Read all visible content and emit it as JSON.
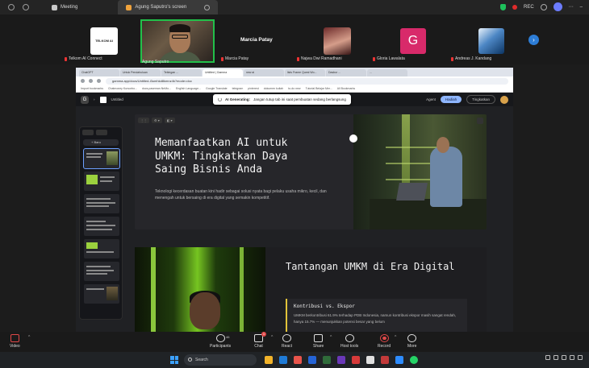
{
  "zoom_top": {
    "tabs": [
      "Meeting",
      "Agung Saputro's screen"
    ],
    "rec_label": "REC"
  },
  "participants": {
    "telkom_logo_text": "TELKOM AI CONNECT",
    "tiles": [
      "Telkom AI Connect",
      "Agung Saputro",
      "Marcia Patay",
      "Najwa Dwi Ramadhani",
      "Gloria Lawalata",
      "Andreas J. Kandang"
    ],
    "featured_name": "Marcia Patay",
    "gloria_initial": "G"
  },
  "browser": {
    "tabs": [
      "ChatGPT",
      "Untuk Pendahuluan",
      "Tebingan ...",
      "Untitled | Gamma",
      "new ai",
      "lists Frame Quest Wo...",
      "Dasbor ...",
      "..."
    ],
    "url": "gamma.app/docs/Untitled-i3umhkd8kmnz4k?mode=doc",
    "bookmarks": [
      "Import bookmarks",
      "Chatmoney Kursorbo...",
      "docs.paseman.NeMo...",
      "English Language...",
      "Google Translate",
      "telegram",
      "pinterest",
      "dokumen kuliah",
      "to-do new",
      "Tutorial Belajar Mer...",
      "All Bookmarks"
    ]
  },
  "gamma": {
    "doc_name": "Untitled",
    "ai_label": "AI Generating:",
    "ai_message": "Jangan tutup tab ini saat pembuatan sedang berlangsung",
    "agent_label": "Agent",
    "present_label": "Hadiah",
    "upgrade_label": "Tingkatkan",
    "new_label": "+ Baru"
  },
  "slide1": {
    "title": "Memanfaatkan AI untuk UMKM: Tingkatkan Daya Saing Bisnis Anda",
    "body": "Teknologi kecerdasan buatan kini hadir sebagai solusi nyata bagi pelaku usaha mikro, kecil, dan menengah untuk bersaing di era digital yang semakin kompetitif."
  },
  "slide2": {
    "title": "Tantangan UMKM di Era Digital",
    "card_heading": "Kontribusi vs. Ekspor",
    "card_text": "UMKM berkontribusi 61.9% terhadap PDB Indonesia, namun kontribusi ekspor masih sangat rendah, hanya 15.7% — menunjukkan potensi besar yang belum"
  },
  "controls": {
    "video": "Video",
    "participants": "Participants",
    "participants_count": "46",
    "chat": "Chat",
    "chat_badge": "1",
    "react": "React",
    "share": "Share",
    "host_tools": "Host tools",
    "record": "Record",
    "more": "More"
  },
  "taskbar": {
    "search_placeholder": "Search"
  }
}
